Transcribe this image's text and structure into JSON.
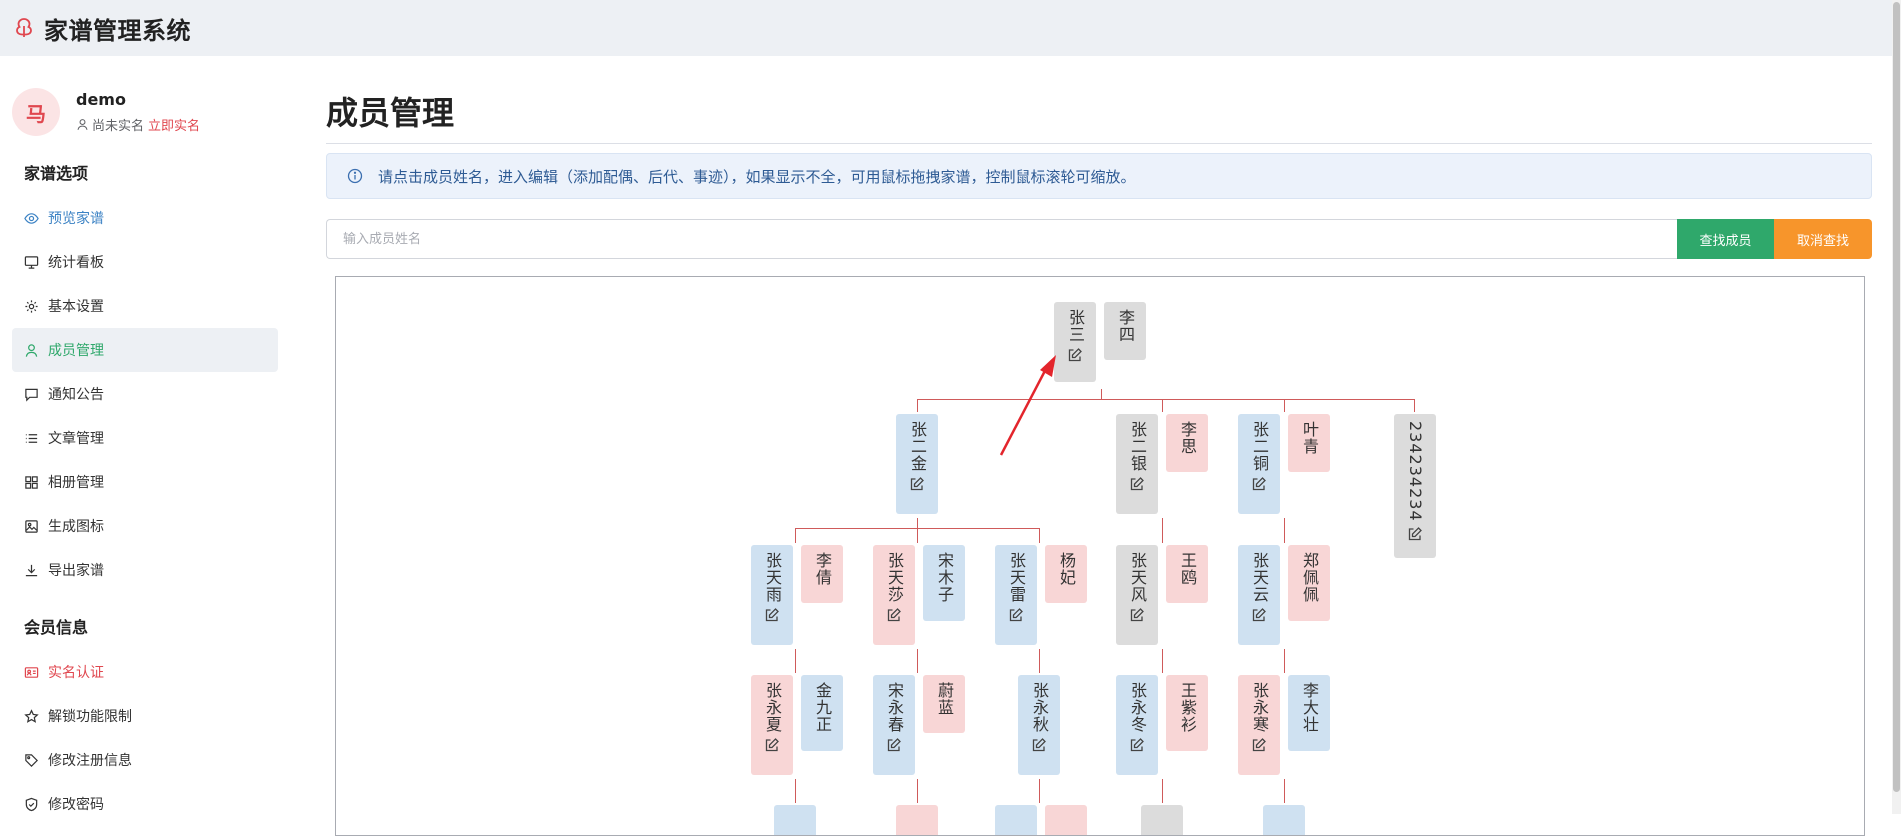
{
  "header": {
    "app_title": "家谱管理系统",
    "logo_icon": "tree-icon"
  },
  "user": {
    "avatar_text": "马",
    "name": "demo",
    "status": "尚未实名",
    "verify_link": "立即实名"
  },
  "sidebar": {
    "section1_title": "家谱选项",
    "items1": [
      {
        "label": "预览家谱",
        "icon": "eye-icon"
      },
      {
        "label": "统计看板",
        "icon": "monitor-icon"
      },
      {
        "label": "基本设置",
        "icon": "gear-icon"
      },
      {
        "label": "成员管理",
        "icon": "user-icon"
      },
      {
        "label": "通知公告",
        "icon": "chat-icon"
      },
      {
        "label": "文章管理",
        "icon": "list-icon"
      },
      {
        "label": "相册管理",
        "icon": "grid-icon"
      },
      {
        "label": "生成图标",
        "icon": "image-icon"
      },
      {
        "label": "导出家谱",
        "icon": "download-icon"
      }
    ],
    "section2_title": "会员信息",
    "items2": [
      {
        "label": "实名认证",
        "icon": "id-card-icon"
      },
      {
        "label": "解锁功能限制",
        "icon": "star-icon"
      },
      {
        "label": "修改注册信息",
        "icon": "tag-icon"
      },
      {
        "label": "修改密码",
        "icon": "shield-icon"
      }
    ]
  },
  "main": {
    "title": "成员管理",
    "notice": "请点击成员姓名，进入编辑（添加配偶、后代、事迹），如果显示不全，可用鼠标拖拽家谱，控制鼠标滚轮可缩放。",
    "search_placeholder": "输入成员姓名",
    "find_button": "查找成员",
    "cancel_button": "取消查找"
  },
  "tree": {
    "gen1": {
      "name": "张三",
      "spouse": "李四"
    },
    "gen2": [
      {
        "name": "张二金"
      },
      {
        "name": "张二银",
        "spouse": "李思"
      },
      {
        "name": "张二铜",
        "spouse": "叶青"
      },
      {
        "name": "23423423​4"
      }
    ],
    "gen3": [
      {
        "name": "张天雨",
        "spouse": "李倩"
      },
      {
        "name": "张天莎",
        "spouse": "宋木子"
      },
      {
        "name": "张天雷",
        "spouse": "杨妃"
      },
      {
        "name": "张天风",
        "spouse": "王鸥"
      },
      {
        "name": "张天云",
        "spouse": "郑佩佩"
      }
    ],
    "gen4": [
      {
        "name": "张永夏",
        "spouse": "金九正"
      },
      {
        "name": "宋永春",
        "spouse": "蔚蓝"
      },
      {
        "name": "张永秋"
      },
      {
        "name": "张永冬",
        "spouse": "王紫衫"
      },
      {
        "name": "张永寒",
        "spouse": "李大壮"
      }
    ]
  },
  "colors": {
    "accent_green": "#2fa86b",
    "accent_orange": "#f7952b",
    "accent_red": "#e0474f",
    "line_red": "#cf5a5a"
  }
}
